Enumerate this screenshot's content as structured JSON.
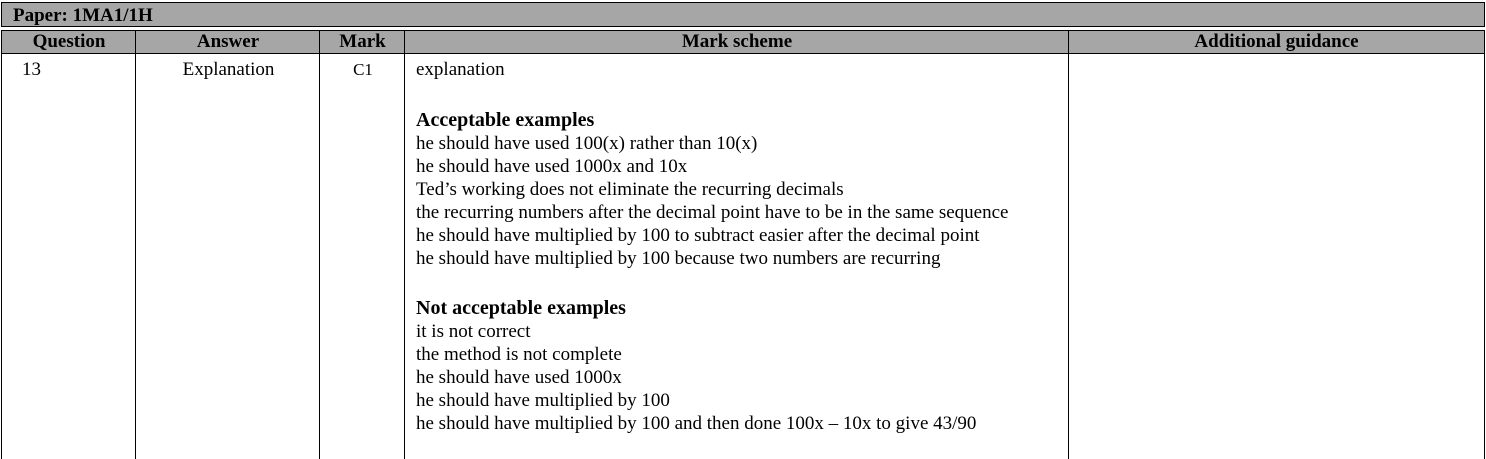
{
  "paper": {
    "title": "Paper: 1MA1/1H"
  },
  "table": {
    "headers": {
      "question": "Question",
      "answer": "Answer",
      "mark": "Mark",
      "mark_scheme": "Mark scheme",
      "additional_guidance": "Additional guidance"
    },
    "row": {
      "question": "13",
      "answer": "Explanation",
      "mark": "C1",
      "mark_scheme_intro": "explanation",
      "acceptable_heading": "Acceptable examples",
      "acceptable": [
        "he should have used 100(x) rather than 10(x)",
        "he should have used 1000x and 10x",
        "Ted’s working does not eliminate the recurring decimals",
        "the recurring numbers after the decimal point have to be in the same sequence",
        "he should have multiplied by 100 to subtract easier after the decimal point",
        "he should have multiplied by 100 because two numbers are recurring"
      ],
      "not_acceptable_heading": "Not acceptable examples",
      "not_acceptable": [
        "it is not correct",
        "the method is not complete",
        "he should have used 1000x",
        "he should have multiplied by 100",
        "he should have multiplied by 100 and then done 100x – 10x to give 43/90"
      ],
      "additional_guidance": ""
    }
  }
}
